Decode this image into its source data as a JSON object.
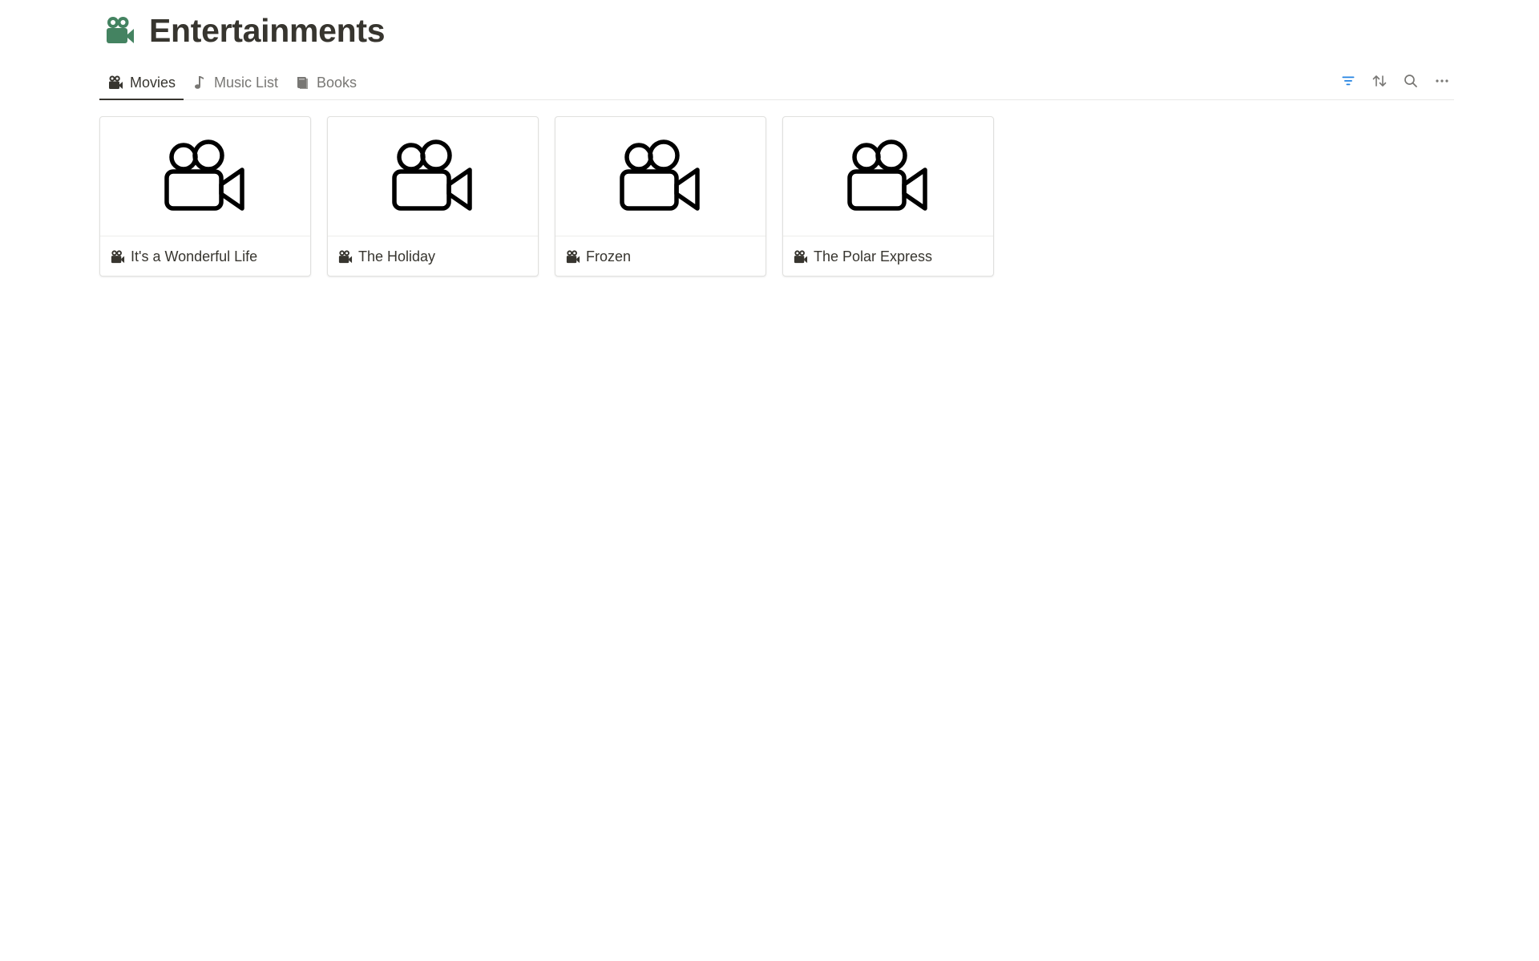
{
  "page": {
    "title": "Entertainments",
    "title_icon": "movie-camera-icon",
    "title_icon_color": "#448361"
  },
  "tabs": [
    {
      "label": "Movies",
      "icon": "movie-camera-icon",
      "active": true
    },
    {
      "label": "Music List",
      "icon": "music-note-icon",
      "active": false
    },
    {
      "label": "Books",
      "icon": "book-icon",
      "active": false
    }
  ],
  "toolbar": {
    "filter_icon": "filter-icon",
    "filter_color": "#2383e2",
    "sort_icon": "sort-icon",
    "search_icon": "search-icon",
    "more_icon": "more-icon"
  },
  "gallery": {
    "cards": [
      {
        "title": "It's a Wonderful Life",
        "icon": "movie-camera-icon"
      },
      {
        "title": "The Holiday",
        "icon": "movie-camera-icon"
      },
      {
        "title": "Frozen",
        "icon": "movie-camera-icon"
      },
      {
        "title": "The Polar Express",
        "icon": "movie-camera-icon"
      }
    ]
  }
}
